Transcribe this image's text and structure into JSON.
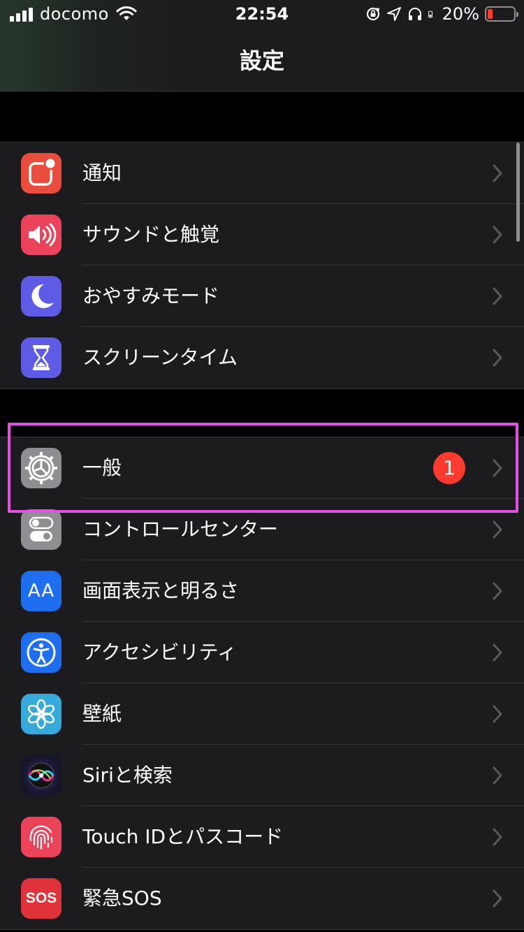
{
  "status_bar": {
    "carrier": "docomo",
    "time": "22:54",
    "battery_percent": "20%",
    "battery_level": 0.2,
    "icons": [
      "signal-icon",
      "wifi-icon",
      "rotation-lock-icon",
      "location-icon",
      "headphones-icon",
      "battery-icon"
    ]
  },
  "nav": {
    "title": "設定"
  },
  "group1": [
    {
      "label": "通知",
      "icon": "notifications-icon",
      "color": "#eb4d3d"
    },
    {
      "label": "サウンドと触覚",
      "icon": "sound-icon",
      "color": "#eb445a"
    },
    {
      "label": "おやすみモード",
      "icon": "moon-icon",
      "color": "#5e5ce6"
    },
    {
      "label": "スクリーンタイム",
      "icon": "hourglass-icon",
      "color": "#5e5ce6"
    }
  ],
  "group2": [
    {
      "label": "一般",
      "icon": "gear-icon",
      "color": "#8e8e93",
      "badge": "1"
    },
    {
      "label": "コントロールセンター",
      "icon": "toggle-icon",
      "color": "#8e8e93"
    },
    {
      "label": "画面表示と明るさ",
      "icon": "text-size-icon",
      "color": "#1f6ef0",
      "icon_text": "AA"
    },
    {
      "label": "アクセシビリティ",
      "icon": "accessibility-icon",
      "color": "#1f6ef0"
    },
    {
      "label": "壁紙",
      "icon": "flower-icon",
      "color": "#37aadc"
    },
    {
      "label": "Siriと検索",
      "icon": "siri-icon",
      "color": "#1c1c2e"
    },
    {
      "label": "Touch IDとパスコード",
      "icon": "fingerprint-icon",
      "color": "#eb445a"
    },
    {
      "label": "緊急SOS",
      "icon": "sos-icon",
      "color": "#e0323a",
      "icon_text": "SOS"
    }
  ],
  "highlight_color": "#e84de6"
}
